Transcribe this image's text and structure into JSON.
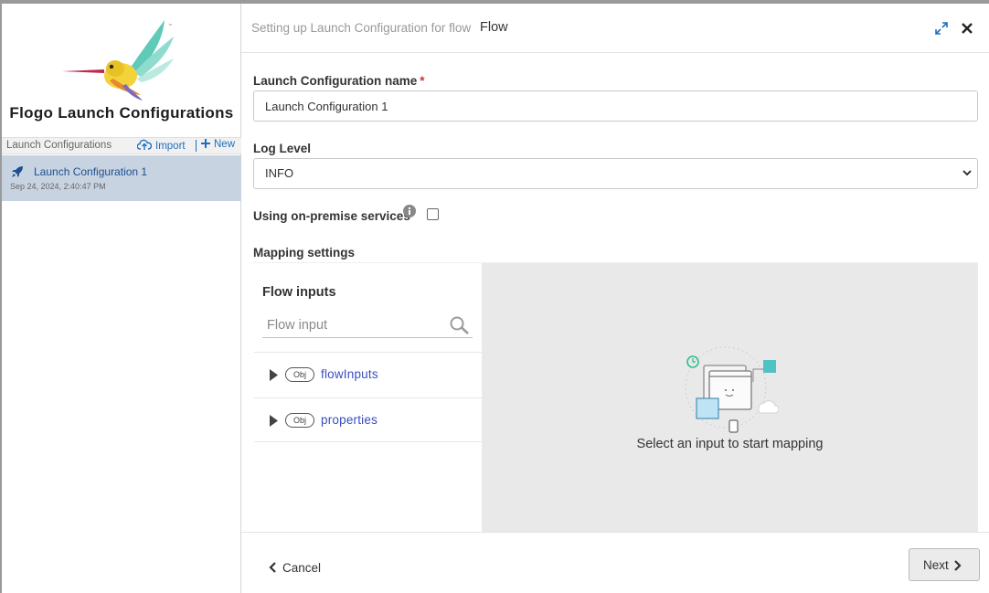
{
  "left": {
    "app_title": "Flogo Launch Configurations",
    "list_header": "Launch Configurations",
    "import_label": "Import",
    "new_label": "New",
    "items": [
      {
        "name": "Launch Configuration 1",
        "date": "Sep 24, 2024, 2:40:47 PM"
      }
    ]
  },
  "header": {
    "setup_text": "Setting up Launch Configuration for flow",
    "flow_name": "Flow"
  },
  "form": {
    "name_label": "Launch Configuration name",
    "required_mark": "*",
    "name_value": "Launch Configuration 1",
    "log_level_label": "Log Level",
    "log_level_value": "INFO",
    "on_premise_label": "Using on-premise services",
    "mapping_label": "Mapping settings"
  },
  "mapping": {
    "inputs_title": "Flow inputs",
    "search_placeholder": "Flow input",
    "tree": [
      {
        "badge": "Obj",
        "name": "flowInputs"
      },
      {
        "badge": "Obj",
        "name": "properties"
      }
    ],
    "empty_message": "Select an input to start mapping"
  },
  "footer": {
    "cancel_label": "Cancel",
    "next_label": "Next"
  },
  "colors": {
    "accent": "#1f6fbf",
    "selected_item_bg": "#c8d3e2",
    "tree_link": "#3a4ec1",
    "required": "#c0392b"
  }
}
